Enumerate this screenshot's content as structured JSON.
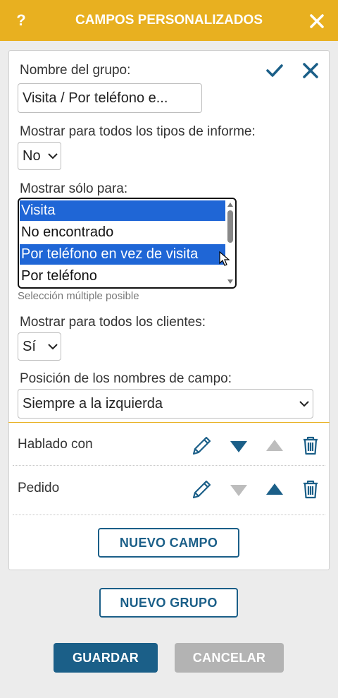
{
  "header": {
    "help_label": "?",
    "title": "CAMPOS PERSONALIZADOS",
    "accent_color": "#e8b020"
  },
  "group_form": {
    "name_label": "Nombre del grupo:",
    "name_value": "Visita / Por teléfono e...",
    "show_all_report_types_label": "Mostrar para todos los tipos de informe:",
    "show_all_report_types_value": "No",
    "show_only_for_label": "Mostrar sólo para:",
    "show_only_for_options": [
      {
        "label": "Visita",
        "selected": true
      },
      {
        "label": "No encontrado",
        "selected": false
      },
      {
        "label": "Por teléfono en vez de visita",
        "selected": true
      },
      {
        "label": "Por teléfono",
        "selected": false
      }
    ],
    "multi_select_hint": "Selección múltiple posible",
    "show_all_clients_label": "Mostrar para todos los clientes:",
    "show_all_clients_value": "Sí",
    "field_name_position_label": "Posición de los nombres de campo:",
    "field_name_position_value": "Siempre a la izquierda"
  },
  "fields": [
    {
      "name": "Hablado con",
      "can_move_down": true,
      "can_move_up": false
    },
    {
      "name": "Pedido",
      "can_move_down": false,
      "can_move_up": true
    }
  ],
  "buttons": {
    "new_field": "NUEVO CAMPO",
    "new_group": "NUEVO GRUPO",
    "save": "GUARDAR",
    "cancel": "CANCELAR"
  },
  "colors": {
    "primary": "#1b5f88",
    "disabled": "#b3b3b3",
    "selection": "#1f66d6",
    "icon_inactive": "#bdbdbd"
  }
}
